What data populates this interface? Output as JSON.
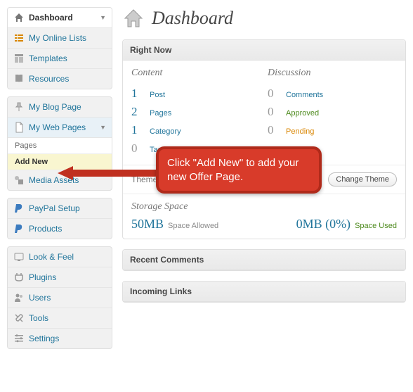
{
  "page": {
    "title": "Dashboard"
  },
  "sidebar": {
    "group1": [
      {
        "label": "Dashboard",
        "icon": "home"
      },
      {
        "label": "My Online Lists",
        "icon": "list"
      },
      {
        "label": "Templates",
        "icon": "template"
      },
      {
        "label": "Resources",
        "icon": "book"
      }
    ],
    "group2": [
      {
        "label": "My Blog Page",
        "icon": "pin"
      },
      {
        "label": "My Web Pages",
        "icon": "page",
        "expanded": true,
        "submenu": [
          "Pages",
          "Add New"
        ]
      },
      {
        "label": "Media Assets",
        "icon": "media"
      }
    ],
    "group3": [
      {
        "label": "PayPal Setup",
        "icon": "paypal"
      },
      {
        "label": "Products",
        "icon": "paypal"
      }
    ],
    "group4": [
      {
        "label": "Look & Feel",
        "icon": "appearance"
      },
      {
        "label": "Plugins",
        "icon": "plugin"
      },
      {
        "label": "Users",
        "icon": "users"
      },
      {
        "label": "Tools",
        "icon": "tools"
      },
      {
        "label": "Settings",
        "icon": "settings"
      }
    ]
  },
  "rightnow": {
    "title": "Right Now",
    "contentHeading": "Content",
    "discussionHeading": "Discussion",
    "content": [
      {
        "num": "1",
        "label": "Post"
      },
      {
        "num": "2",
        "label": "Pages"
      },
      {
        "num": "1",
        "label": "Category"
      },
      {
        "num": "0",
        "label": "Tags"
      }
    ],
    "discussion": [
      {
        "num": "0",
        "label": "Comments"
      },
      {
        "num": "0",
        "label": "Approved",
        "cls": "approved"
      },
      {
        "num": "0",
        "label": "Pending",
        "cls": "pending"
      }
    ],
    "themePrefix": "Theme",
    "changeTheme": "Change Theme",
    "storageHeading": "Storage Space",
    "allowedVal": "50MB",
    "allowedLabel": "Space Allowed",
    "usedVal": "0MB (0%)",
    "usedLabel": "Space Used"
  },
  "panels": {
    "recentComments": "Recent Comments",
    "incomingLinks": "Incoming Links"
  },
  "callout": {
    "text": "Click \"Add New\" to add your new Offer Page."
  }
}
